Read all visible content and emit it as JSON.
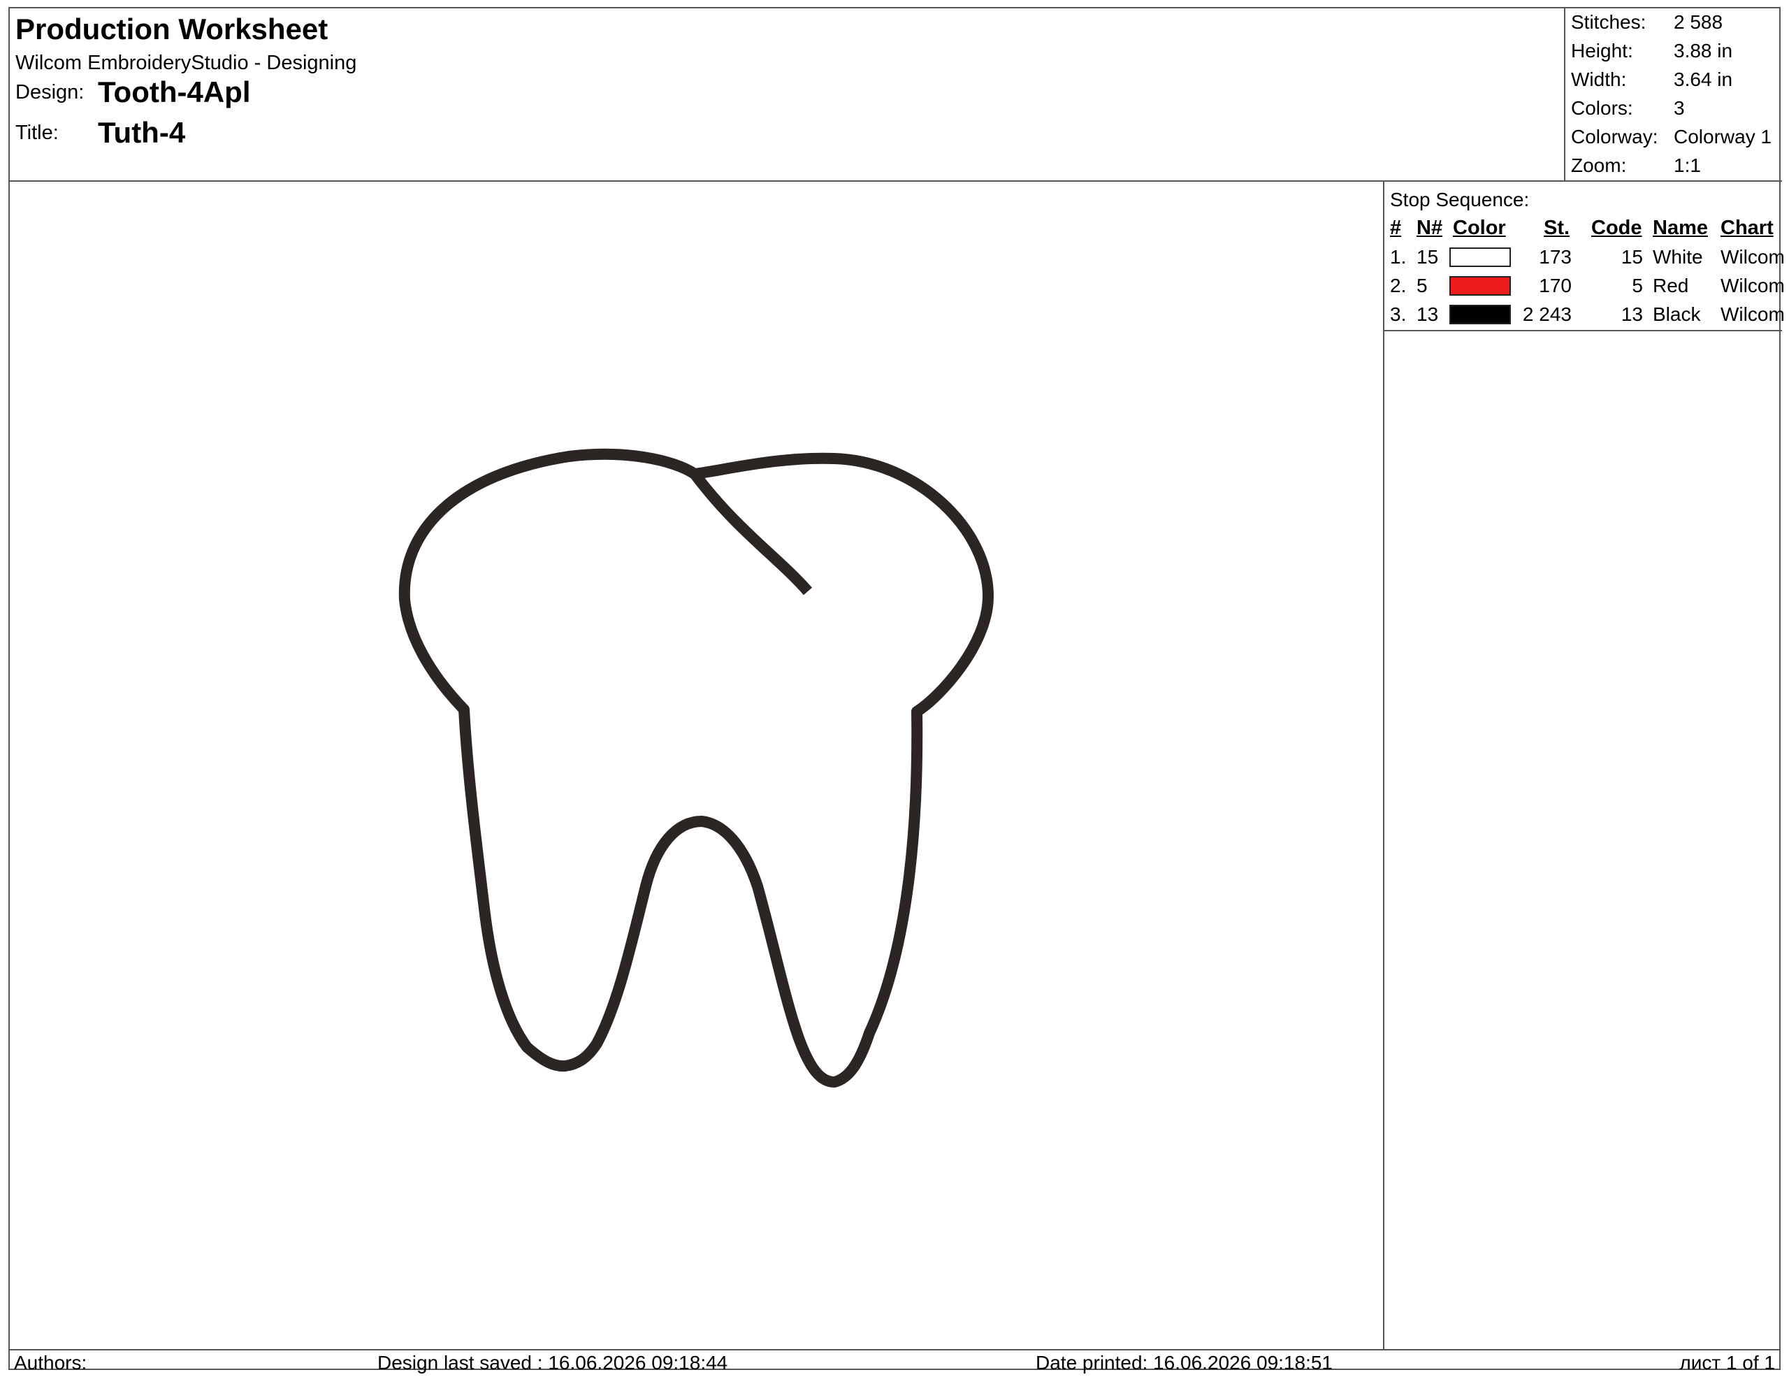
{
  "header": {
    "title": "Production Worksheet",
    "subtitle": "Wilcom EmbroideryStudio - Designing",
    "design_label": "Design:",
    "design_value": "Tooth-4Apl",
    "title_label": "Title:",
    "title_value": "Tuth-4"
  },
  "stats": [
    {
      "label": "Stitches:",
      "value": "2 588"
    },
    {
      "label": "Height:",
      "value": "3.88 in"
    },
    {
      "label": "Width:",
      "value": "3.64 in"
    },
    {
      "label": "Colors:",
      "value": "3"
    },
    {
      "label": "Colorway:",
      "value": "Colorway 1"
    },
    {
      "label": "Zoom:",
      "value": "1:1"
    }
  ],
  "stop_sequence": {
    "title": "Stop Sequence:",
    "headers": {
      "num": "#",
      "n": "N#",
      "color": "Color",
      "st": "St.",
      "code": "Code",
      "name": "Name",
      "chart": "Chart"
    },
    "rows": [
      {
        "num": "1.",
        "n": "15",
        "color": "#ffffff",
        "st": "173",
        "code": "15",
        "name": "White",
        "chart": "Wilcom"
      },
      {
        "num": "2.",
        "n": "5",
        "color": "#ee1c1c",
        "st": "170",
        "code": "5",
        "name": "Red",
        "chart": "Wilcom"
      },
      {
        "num": "3.",
        "n": "13",
        "color": "#000000",
        "st": "2 243",
        "code": "13",
        "name": "Black",
        "chart": "Wilcom"
      }
    ]
  },
  "design": {
    "outline_color": "#2b2523"
  },
  "footer": {
    "authors": "Authors:",
    "last_saved": "Design last saved : 16.06.2026 09:18:44",
    "date_printed": "Date printed: 16.06.2026 09:18:51",
    "page": "лист 1 of 1"
  }
}
